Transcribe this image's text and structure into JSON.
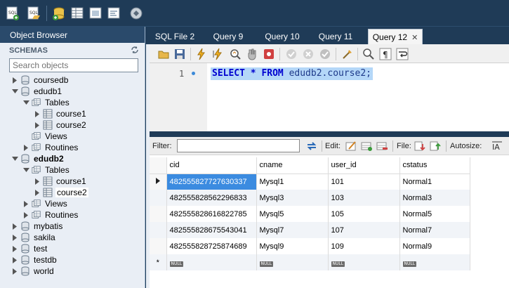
{
  "sidebar": {
    "header": "Object Browser",
    "schemas_label": "SCHEMAS",
    "search_placeholder": "Search objects",
    "tree": [
      {
        "label": "coursedb",
        "type": "db",
        "arrow": "right"
      },
      {
        "label": "edudb1",
        "type": "db",
        "arrow": "down"
      },
      {
        "label": "Tables",
        "type": "folder",
        "arrow": "down"
      },
      {
        "label": "course1",
        "type": "table",
        "arrow": "right"
      },
      {
        "label": "course2",
        "type": "table",
        "arrow": "right"
      },
      {
        "label": "Views",
        "type": "folder",
        "arrow": "none"
      },
      {
        "label": "Routines",
        "type": "folder",
        "arrow": "right"
      },
      {
        "label": "edudb2",
        "type": "db",
        "arrow": "down",
        "bold": true
      },
      {
        "label": "Tables",
        "type": "folder",
        "arrow": "down"
      },
      {
        "label": "course1",
        "type": "table",
        "arrow": "right"
      },
      {
        "label": "course2",
        "type": "table",
        "arrow": "right",
        "selected": true
      },
      {
        "label": "Views",
        "type": "folder",
        "arrow": "right"
      },
      {
        "label": "Routines",
        "type": "folder",
        "arrow": "right"
      },
      {
        "label": "mybatis",
        "type": "db",
        "arrow": "right"
      },
      {
        "label": "sakila",
        "type": "db",
        "arrow": "right"
      },
      {
        "label": "test",
        "type": "db",
        "arrow": "right"
      },
      {
        "label": "testdb",
        "type": "db",
        "arrow": "right"
      },
      {
        "label": "world",
        "type": "db",
        "arrow": "right"
      }
    ]
  },
  "tabs": [
    {
      "label": "SQL File 2",
      "active": false
    },
    {
      "label": "Query 9",
      "active": false
    },
    {
      "label": "Query 10",
      "active": false
    },
    {
      "label": "Query 11",
      "active": false
    },
    {
      "label": "Query 12",
      "active": true,
      "close": "✕"
    }
  ],
  "editor": {
    "line_number": "1",
    "code_keywords_1": "SELECT * FROM",
    "code_rest": " edudb2.course2;"
  },
  "result_toolbar": {
    "filter_label": "Filter:",
    "edit_label": "Edit:",
    "file_label": "File:",
    "autosize_label": "Autosize:"
  },
  "grid": {
    "columns": [
      "cid",
      "cname",
      "user_id",
      "cstatus"
    ],
    "rows": [
      [
        "482555827727630337",
        "Mysql1",
        "101",
        "Normal1"
      ],
      [
        "482555828562296833",
        "Mysql3",
        "103",
        "Normal3"
      ],
      [
        "482555828616822785",
        "Mysql5",
        "105",
        "Normal5"
      ],
      [
        "482555828675543041",
        "Mysql7",
        "107",
        "Normal7"
      ],
      [
        "482555828725874689",
        "Mysql9",
        "109",
        "Normal9"
      ]
    ],
    "null_text": "NULL",
    "new_row_marker": "*"
  },
  "colors": {
    "chrome": "#1f3b57",
    "selection": "#3b8be0",
    "code_highlight": "#b4d7f8"
  }
}
